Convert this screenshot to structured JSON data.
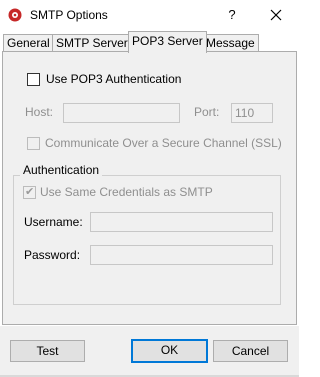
{
  "window": {
    "title": "SMTP Options",
    "help_glyph": "?",
    "close_glyph": "✕",
    "app_icon": "smtp-app-icon"
  },
  "tabs": [
    {
      "label": "General",
      "active": false
    },
    {
      "label": "SMTP Server",
      "active": false
    },
    {
      "label": "POP3 Server",
      "active": true
    },
    {
      "label": "Message",
      "active": false
    }
  ],
  "pop3": {
    "use_auth_label": "Use POP3 Authentication",
    "use_auth_checked": false,
    "host_label": "Host:",
    "host_value": "",
    "port_label": "Port:",
    "port_value": "110",
    "ssl_label": "Communicate Over a Secure Channel (SSL)",
    "ssl_checked": false
  },
  "authentication": {
    "legend": "Authentication",
    "same_creds_label": "Use Same Credentials as SMTP",
    "same_creds_checked": true,
    "username_label": "Username:",
    "username_value": "",
    "password_label": "Password:",
    "password_value": ""
  },
  "buttons": {
    "test": "Test",
    "ok": "OK",
    "cancel": "Cancel"
  }
}
